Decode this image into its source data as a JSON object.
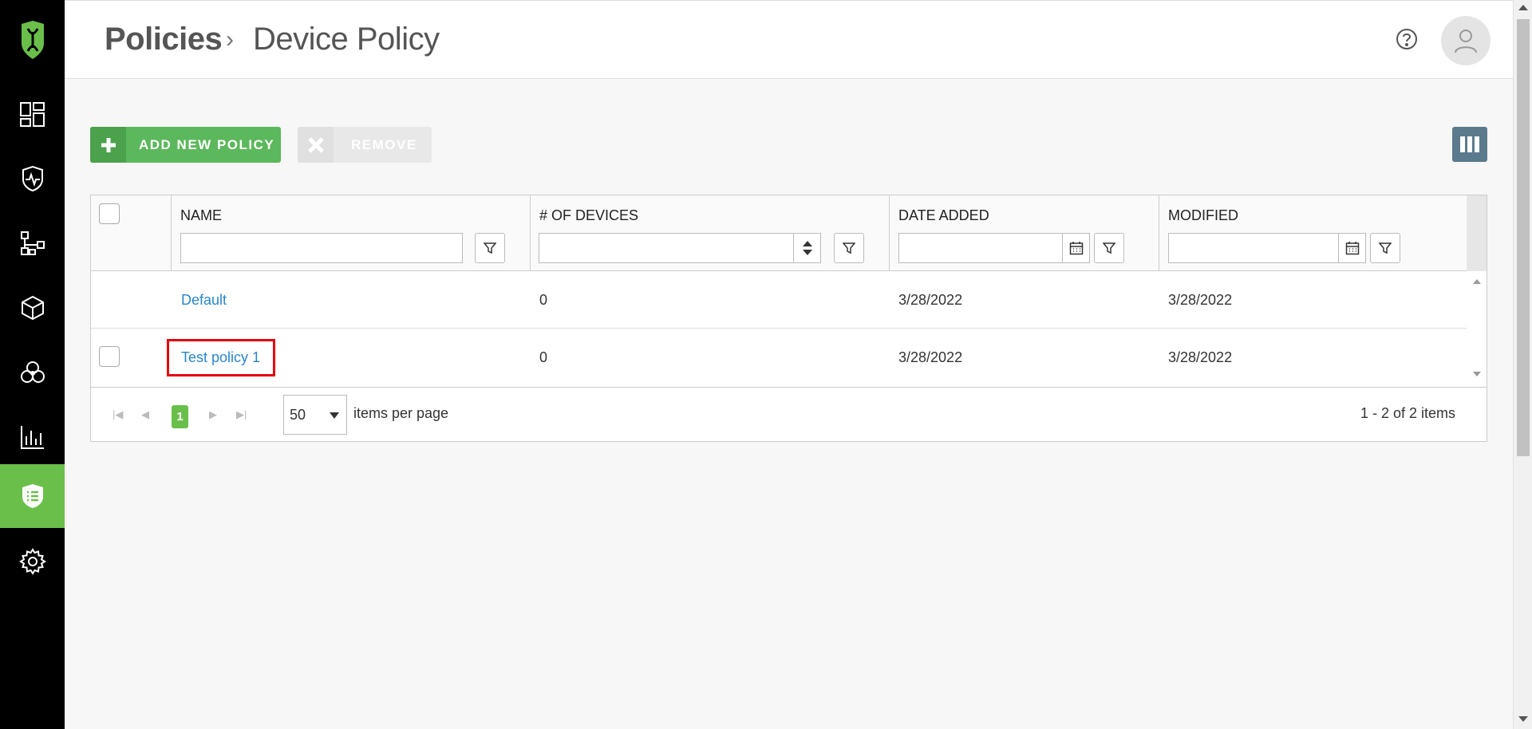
{
  "breadcrumb": {
    "root": "Policies",
    "separator": "›",
    "current": "Device Policy"
  },
  "sidebar": {
    "items": [
      {
        "icon": "dashboard-icon"
      },
      {
        "icon": "shield-pulse-icon"
      },
      {
        "icon": "network-icon"
      },
      {
        "icon": "package-icon"
      },
      {
        "icon": "biohazard-icon"
      },
      {
        "icon": "bar-chart-icon"
      },
      {
        "icon": "policy-shield-icon",
        "active": true
      },
      {
        "icon": "gear-icon"
      }
    ],
    "accent": "#6abf4b"
  },
  "toolbar": {
    "add_label": "ADD NEW POLICY",
    "remove_label": "REMOVE"
  },
  "grid": {
    "columns": [
      "NAME",
      "# OF DEVICES",
      "DATE ADDED",
      "MODIFIED"
    ],
    "rows": [
      {
        "name": "Default",
        "devices": "0",
        "date_added": "3/28/2022",
        "modified": "3/28/2022",
        "selectable": false
      },
      {
        "name": "Test policy 1",
        "devices": "0",
        "date_added": "3/28/2022",
        "modified": "3/28/2022",
        "selectable": true,
        "highlighted": true
      }
    ]
  },
  "pager": {
    "current_page": "1",
    "page_size": "50",
    "items_per_page_label": "items per page",
    "info": "1 - 2 of 2 items"
  },
  "colors": {
    "add_button": "#5cb85c",
    "link": "#2a87c9",
    "highlight": "#e3000f"
  }
}
